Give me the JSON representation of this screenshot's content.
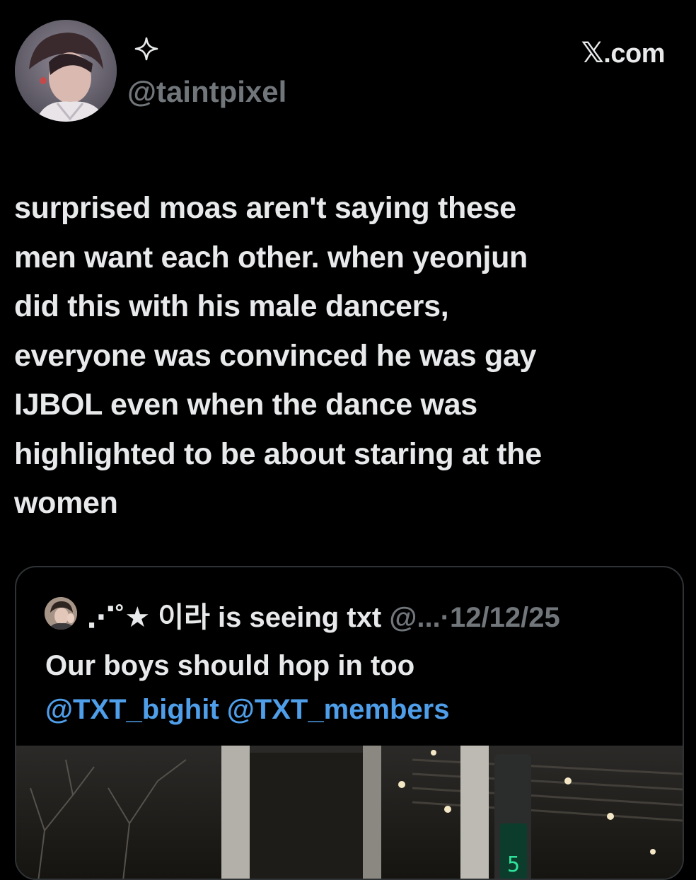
{
  "header": {
    "handle": "@taintpixel",
    "brand": "X.com",
    "brand_x": "𝕏",
    "brand_suffix": ".com"
  },
  "tweet": {
    "lines": [
      "surprised moas aren't saying these",
      "men want each other. when yeonjun",
      "did this with his male dancers,",
      "everyone was convinced he was gay",
      "IJBOL even when the dance was",
      "highlighted to be about staring at the",
      "women"
    ]
  },
  "quote": {
    "display_name": "⋰˚★ 이라 is seeing txt",
    "handle": "@...",
    "separator": "·",
    "date": "12/12/25",
    "text": "Our boys should hop in too",
    "mention_1": "@TXT_bighit",
    "mention_2": "@TXT_members"
  },
  "colors": {
    "background": "#000000",
    "text": "#e7e9ea",
    "secondary": "#71767b",
    "link": "#4f9ee9",
    "border": "#2f3336"
  },
  "icons": {
    "sparkle": "sparkle-icon",
    "avatar": "profile-photo",
    "quote_avatar": "quote-profile-photo",
    "media": "video-thumbnail"
  }
}
